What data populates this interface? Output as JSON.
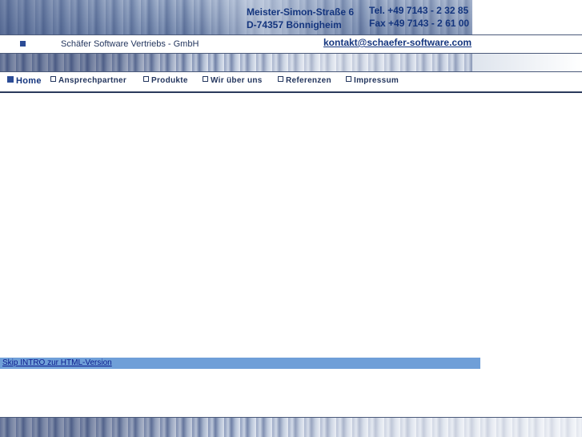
{
  "header": {
    "address_line1": "Meister-Simon-Straße 6",
    "address_line2": "D-74357 Bönnigheim",
    "phone": "Tel. +49 7143 - 2 32 85",
    "fax": "Fax +49 7143 - 2 61 00"
  },
  "company": {
    "name": "Schäfer Software Vertriebs - GmbH",
    "email": "kontakt@schaefer-software.com"
  },
  "nav": {
    "items": [
      {
        "label": "Home",
        "active": true
      },
      {
        "label": "Ansprechpartner",
        "active": false
      },
      {
        "label": "Produkte",
        "active": false
      },
      {
        "label": "Wir über uns",
        "active": false
      },
      {
        "label": "Referenzen",
        "active": false
      },
      {
        "label": "Impressum",
        "active": false
      }
    ]
  },
  "intro": {
    "skip_label": "Skip INTRO zur HTML-Version"
  },
  "colors": {
    "brand_blue": "#14357e",
    "skip_bar": "#6f9fd8"
  }
}
